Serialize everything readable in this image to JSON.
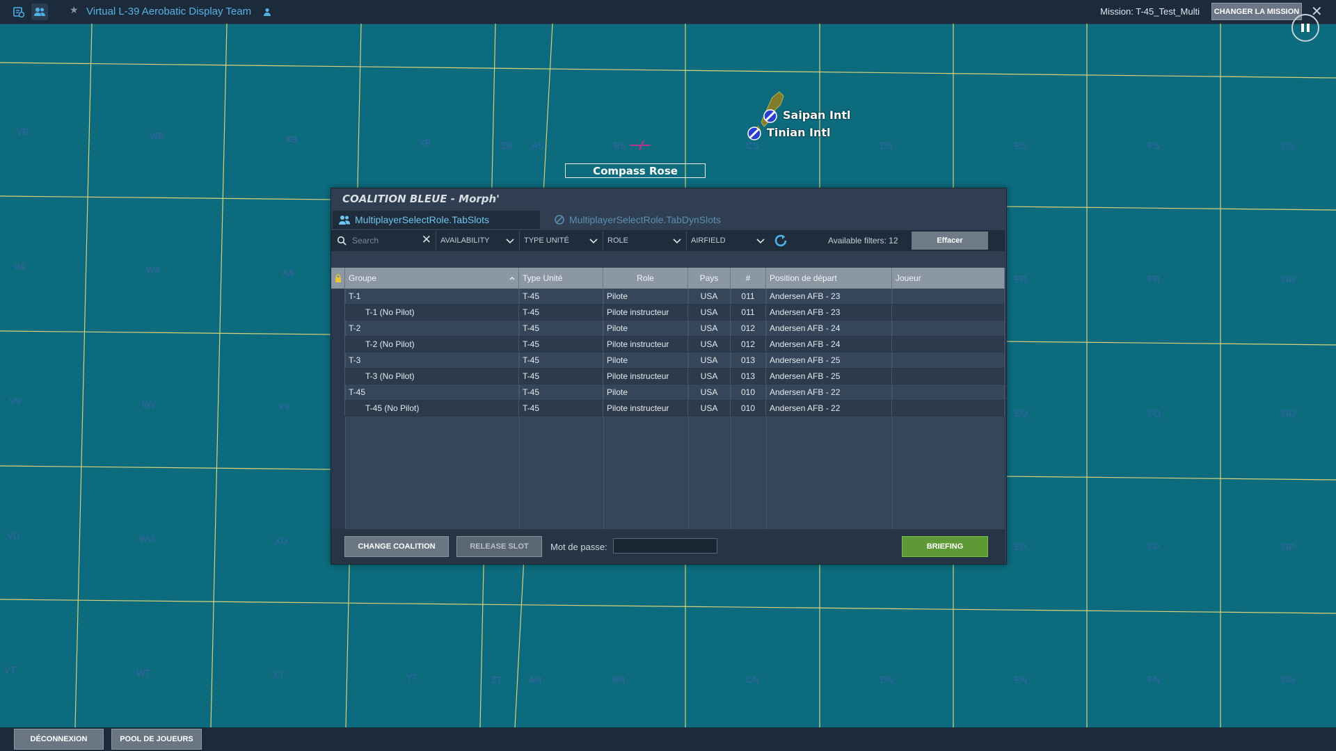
{
  "topbar": {
    "team_name": "Virtual L-39 Aerobatic Display Team",
    "mission_label": "Mission: T-45_Test_Multi",
    "change_mission_label": "CHANGER LA MISSION",
    "close_glyph": "✕"
  },
  "map": {
    "grid_labels": {
      "r1": [
        "VB",
        "WB",
        "XB",
        "YB",
        "ZB",
        "AS",
        "BS",
        "CS",
        "DS",
        "ES",
        "FS",
        "GS"
      ],
      "r2": [
        "VA",
        "WA",
        "XA",
        "ER",
        "FR",
        "GR"
      ],
      "r3": [
        "VV",
        "WV",
        "XV",
        "EQ",
        "FQ",
        "GQ"
      ],
      "r4": [
        "VU",
        "WU",
        "XU",
        "EP",
        "FP",
        "GP"
      ],
      "r5": [
        "VT",
        "WT",
        "XT",
        "YT",
        "ZT",
        "AN",
        "BN",
        "CN",
        "DN",
        "EN",
        "FN",
        "GN"
      ]
    },
    "airports": [
      "Saipan Intl",
      "Tinian Intl"
    ],
    "compass_rose": "Compass Rose"
  },
  "dialog": {
    "title": "COALITION BLEUE - Morph'",
    "tabs": [
      "MultiplayerSelectRole.TabSlots",
      "MultiplayerSelectRole.TabDynSlots"
    ],
    "search_placeholder": "Search",
    "filters": [
      "AVAILABILITY",
      "TYPE UNITÉ",
      "ROLE",
      "AIRFIELD"
    ],
    "available_filters": "Available filters: 12",
    "clear_label": "Effacer",
    "columns": [
      "Groupe",
      "Type Unité",
      "Role",
      "Pays",
      "#",
      "Position de départ",
      "Joueur"
    ],
    "rows": [
      {
        "group": "T-1",
        "type": "T-45",
        "role": "Pilote",
        "country": "USA",
        "num": "011",
        "position": "Andersen AFB - 23",
        "player": "",
        "child": false
      },
      {
        "group": "T-1 (No Pilot)",
        "type": "T-45",
        "role": "Pilote instructeur",
        "country": "USA",
        "num": "011",
        "position": "Andersen AFB - 23",
        "player": "",
        "child": true
      },
      {
        "group": "T-2",
        "type": "T-45",
        "role": "Pilote",
        "country": "USA",
        "num": "012",
        "position": "Andersen AFB - 24",
        "player": "",
        "child": false
      },
      {
        "group": "T-2 (No Pilot)",
        "type": "T-45",
        "role": "Pilote instructeur",
        "country": "USA",
        "num": "012",
        "position": "Andersen AFB - 24",
        "player": "",
        "child": true
      },
      {
        "group": "T-3",
        "type": "T-45",
        "role": "Pilote",
        "country": "USA",
        "num": "013",
        "position": "Andersen AFB - 25",
        "player": "",
        "child": false
      },
      {
        "group": "T-3 (No Pilot)",
        "type": "T-45",
        "role": "Pilote instructeur",
        "country": "USA",
        "num": "013",
        "position": "Andersen AFB - 25",
        "player": "",
        "child": true
      },
      {
        "group": "T-45",
        "type": "T-45",
        "role": "Pilote",
        "country": "USA",
        "num": "010",
        "position": "Andersen AFB - 22",
        "player": "",
        "child": false
      },
      {
        "group": "T-45 (No Pilot)",
        "type": "T-45",
        "role": "Pilote instructeur",
        "country": "USA",
        "num": "010",
        "position": "Andersen AFB - 22",
        "player": "",
        "child": true
      }
    ],
    "change_coalition_label": "CHANGE COALITION",
    "release_slot_label": "RELEASE SLOT",
    "password_label": "Mot de passe:",
    "briefing_label": "BRIEFING"
  },
  "bottombar": {
    "disconnect_label": "DÉCONNEXION",
    "players_pool_label": "POOL DE JOUEURS"
  },
  "colors": {
    "map_bg": "#0c6b7d",
    "grid_line": "#d9d27a",
    "accent_blue": "#57b2e6",
    "briefing_green": "#5d9a35"
  }
}
